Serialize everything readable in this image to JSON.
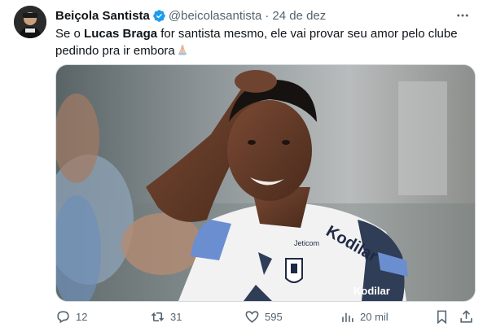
{
  "tweet": {
    "author_name": "Beiçola Santista",
    "author_handle": "@beicolasantista",
    "separator": "·",
    "date": "24 de dez",
    "text_part1": "Se o ",
    "text_bold": "Lucas Braga",
    "text_part2": " for santista mesmo, ele vai provar seu amor pelo clube pedindo pra ir embora",
    "emoji": "praying-hands-emoji",
    "image_icon": "photo-player-smiling",
    "jersey_sponsor": "Kodilar",
    "jersey_sponsor_sleeve": "Kodilar",
    "jersey_small_text": "Jeticom"
  },
  "actions": {
    "replies": "12",
    "retweets": "31",
    "likes": "595",
    "views": "20 mil"
  },
  "colors": {
    "verified": "#1d9bf0",
    "muted": "#536471",
    "text": "#0f1419"
  }
}
